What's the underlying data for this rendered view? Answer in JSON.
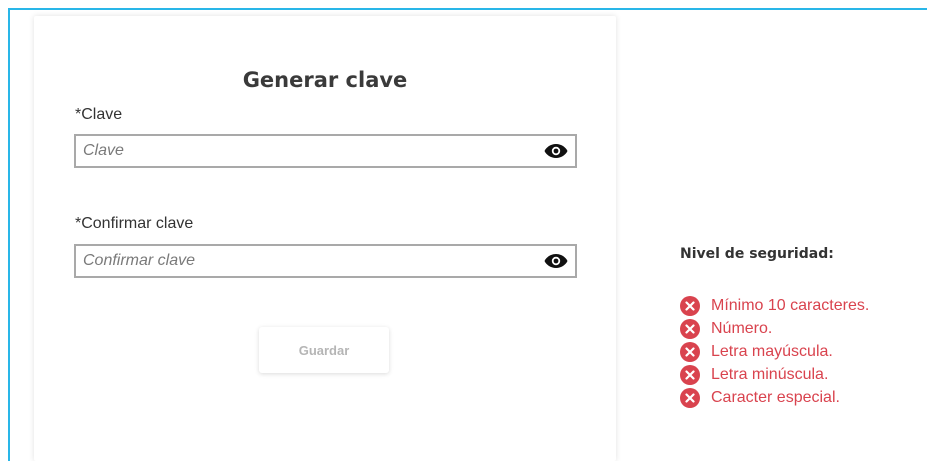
{
  "form": {
    "title": "Generar clave",
    "password_label": "*Clave",
    "password_placeholder": "Clave",
    "confirm_label": "*Confirmar clave",
    "confirm_placeholder": "Confirmar clave",
    "save_label": "Guardar",
    "eye_icon": "eye-icon"
  },
  "security": {
    "title": "Nivel de seguridad:",
    "status_icon": "x-circle-icon",
    "status_color": "#d9434e",
    "requirements": [
      "Mínimo 10 caracteres.",
      "Número.",
      "Letra mayúscula.",
      "Letra minúscula.",
      "Caracter especial."
    ]
  },
  "colors": {
    "frame_border": "#29b6e8",
    "disabled_text": "#b5b5b5"
  }
}
